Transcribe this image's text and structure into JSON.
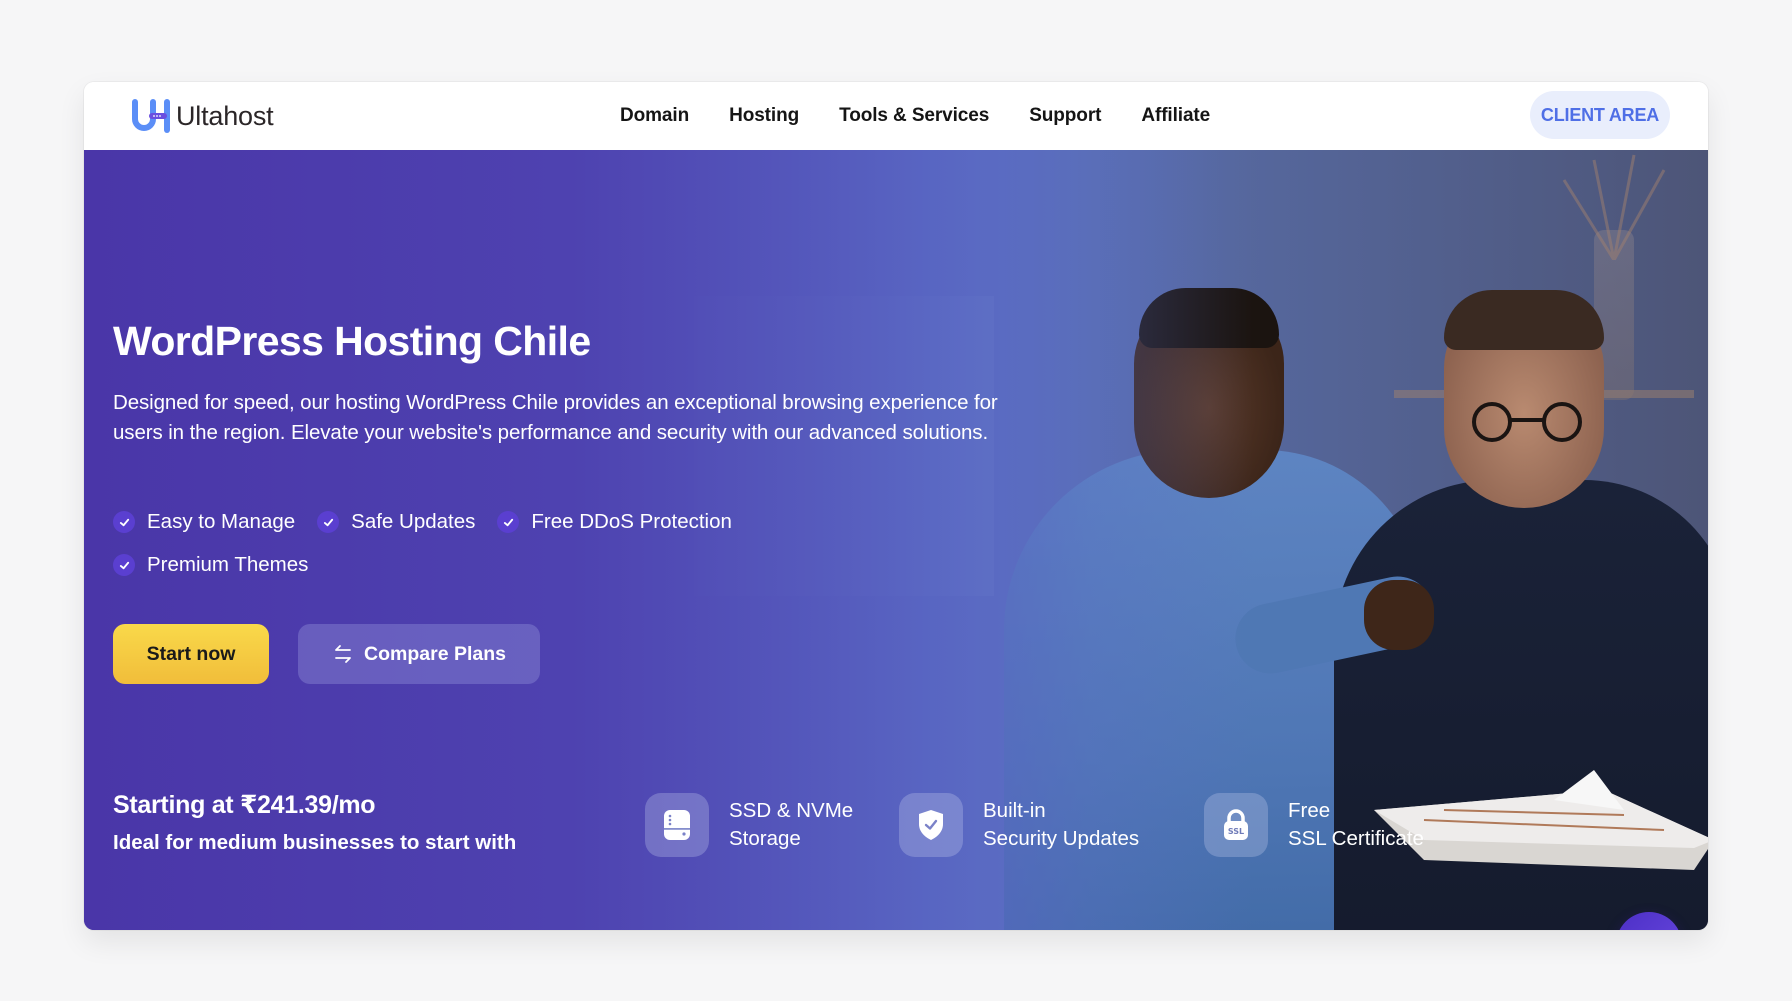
{
  "brand": {
    "name": "Ultahost",
    "logo_icon": "uh-logo-icon",
    "colors": {
      "primary": "#4a36a8",
      "accent_yellow": "#f5c842",
      "client_area_text": "#4f6fe6",
      "client_area_bg": "#e9eefc",
      "chat_bubble": "#5a3fd6"
    }
  },
  "header": {
    "nav": [
      {
        "label": "Domain"
      },
      {
        "label": "Hosting"
      },
      {
        "label": "Tools & Services"
      },
      {
        "label": "Support"
      },
      {
        "label": "Affiliate"
      }
    ],
    "client_area_label": "CLIENT AREA"
  },
  "hero": {
    "title": "WordPress Hosting Chile",
    "description": "Designed for speed, our hosting WordPress Chile provides an exceptional browsing experience for users in the region. Elevate your website's performance and security with our advanced solutions.",
    "features": [
      {
        "label": "Easy to Manage",
        "icon": "check-icon"
      },
      {
        "label": "Safe Updates",
        "icon": "check-icon"
      },
      {
        "label": "Free DDoS Protection",
        "icon": "check-icon"
      },
      {
        "label": "Premium Themes",
        "icon": "check-icon"
      }
    ],
    "buttons": {
      "start": "Start now",
      "compare": "Compare Plans",
      "compare_icon": "arrows-swap-icon"
    },
    "price": "Starting at ₹241.39/mo",
    "price_subtitle": "Ideal for medium businesses to start with",
    "perks": [
      {
        "icon": "storage-drive-icon",
        "line1": "SSD & NVMe",
        "line2": "Storage"
      },
      {
        "icon": "shield-check-icon",
        "line1": "Built-in",
        "line2": "Security Updates"
      },
      {
        "icon": "ssl-lock-icon",
        "line1": "Free",
        "line2": "SSL Certificate"
      }
    ]
  },
  "chat": {
    "icon": "chat-bubble-icon"
  }
}
